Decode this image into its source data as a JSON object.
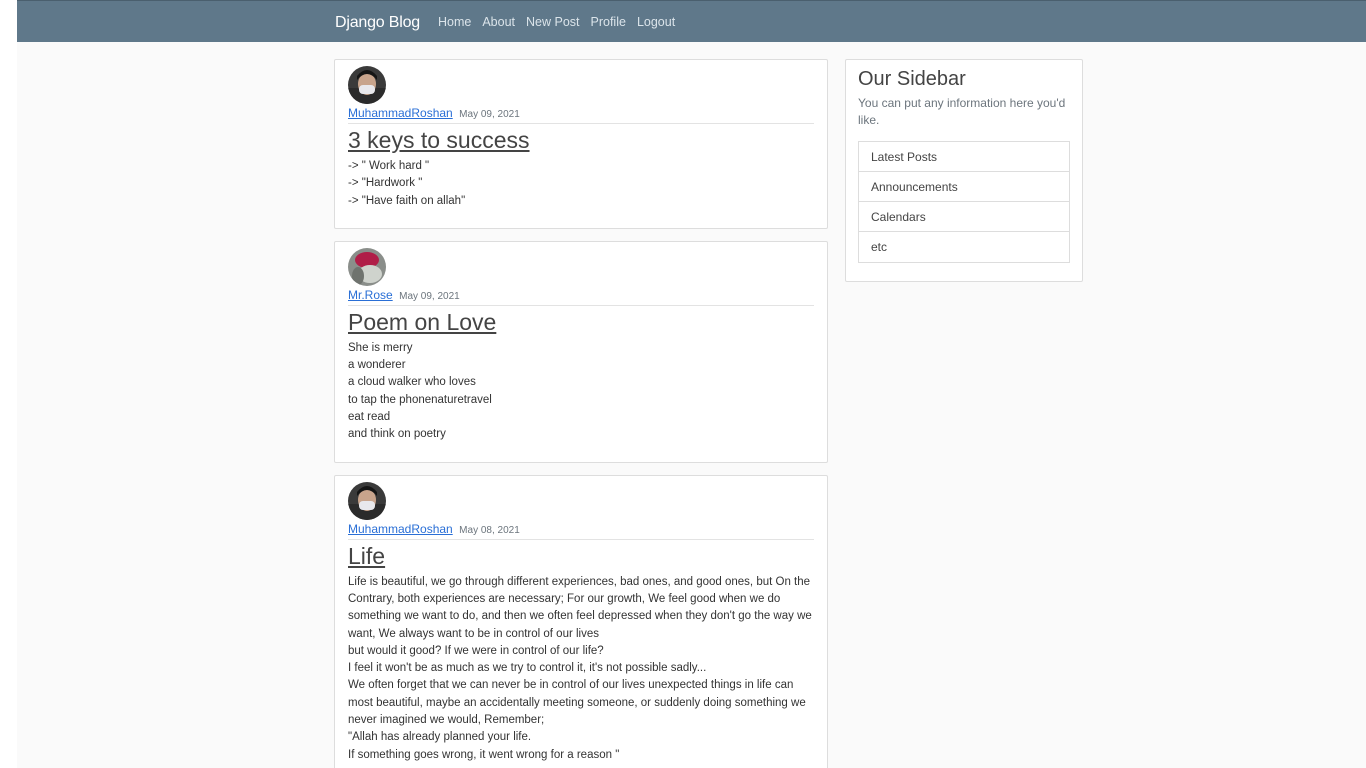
{
  "navbar": {
    "brand": "Django Blog",
    "links": [
      "Home",
      "About",
      "New Post",
      "Profile",
      "Logout"
    ]
  },
  "posts": [
    {
      "author": "MuhammadRoshan",
      "date": "May 09, 2021",
      "title": "3 keys to success",
      "content": "-> \" Work hard \"\n-> \"Hardwork \"\n-> \"Have faith on allah\"",
      "avatar_icon": "user-avatar-icon"
    },
    {
      "author": "Mr.Rose",
      "date": "May 09, 2021",
      "title": "Poem on Love",
      "content": "She is merry\na wonderer\na cloud walker who loves\nto tap the phonenaturetravel\neat read\nand think on poetry",
      "avatar_icon": "user-avatar-icon"
    },
    {
      "author": "MuhammadRoshan",
      "date": "May 08, 2021",
      "title": "Life",
      "content": "Life is beautiful, we go through different experiences, bad ones, and good ones, but On the Contrary, both experiences are necessary; For our growth, We feel good when we do something we want to do, and then we often feel depressed when they don't go the way we want, We always want to be in control of our lives\nbut would it good? If we were in control of our life?\nI feel it won't be as much as we try to control it, it's not possible sadly...\nWe often forget that we can never be in control of our lives unexpected things in life can most beautiful, maybe an accidentally meeting someone, or suddenly doing something we never imagined we would, Remember;\n\"Allah has already planned your life.\nIf something goes wrong, it went wrong for a reason \"",
      "avatar_icon": "user-avatar-icon"
    }
  ],
  "sidebar": {
    "title": "Our Sidebar",
    "description": "You can put any information here you'd like.",
    "items": [
      "Latest Posts",
      "Announcements",
      "Calendars",
      "etc"
    ]
  },
  "colors": {
    "navbar_bg": "#5f788a",
    "link": "#2a6fd6",
    "page_bg": "#fafafa"
  }
}
